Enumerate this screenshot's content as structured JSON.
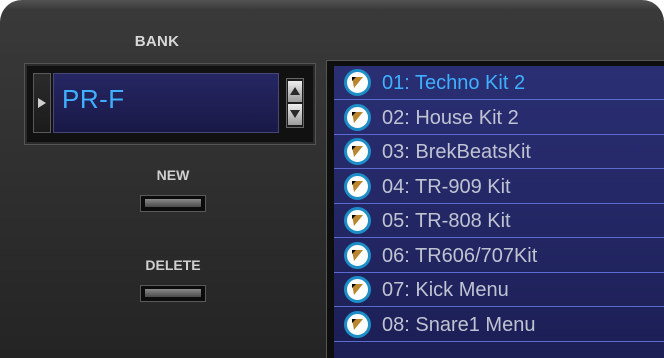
{
  "bank": {
    "label": "BANK",
    "value": "PR-F"
  },
  "buttons": {
    "new_label": "NEW",
    "delete_label": "DELETE"
  },
  "kits": [
    {
      "label": "01: Techno Kit 2",
      "selected": true
    },
    {
      "label": "02: House Kit 2",
      "selected": false
    },
    {
      "label": "03: BrekBeatsKit",
      "selected": false
    },
    {
      "label": "04: TR-909 Kit",
      "selected": false
    },
    {
      "label": "05: TR-808 Kit",
      "selected": false
    },
    {
      "label": "06: TR606/707Kit",
      "selected": false
    },
    {
      "label": "07: Kick Menu",
      "selected": false
    },
    {
      "label": "08: Snare1 Menu",
      "selected": false
    }
  ],
  "colors": {
    "accent": "#3fb0ff",
    "list_background": "#2a2f74",
    "badge_ring": "#1d8ec8",
    "badge_marker": "#b9852e"
  },
  "icons": {
    "bank_select": "triangle-right-icon",
    "spin_up": "triangle-up-icon",
    "spin_down": "triangle-down-icon",
    "row_marker": "orange-wedge-icon"
  }
}
